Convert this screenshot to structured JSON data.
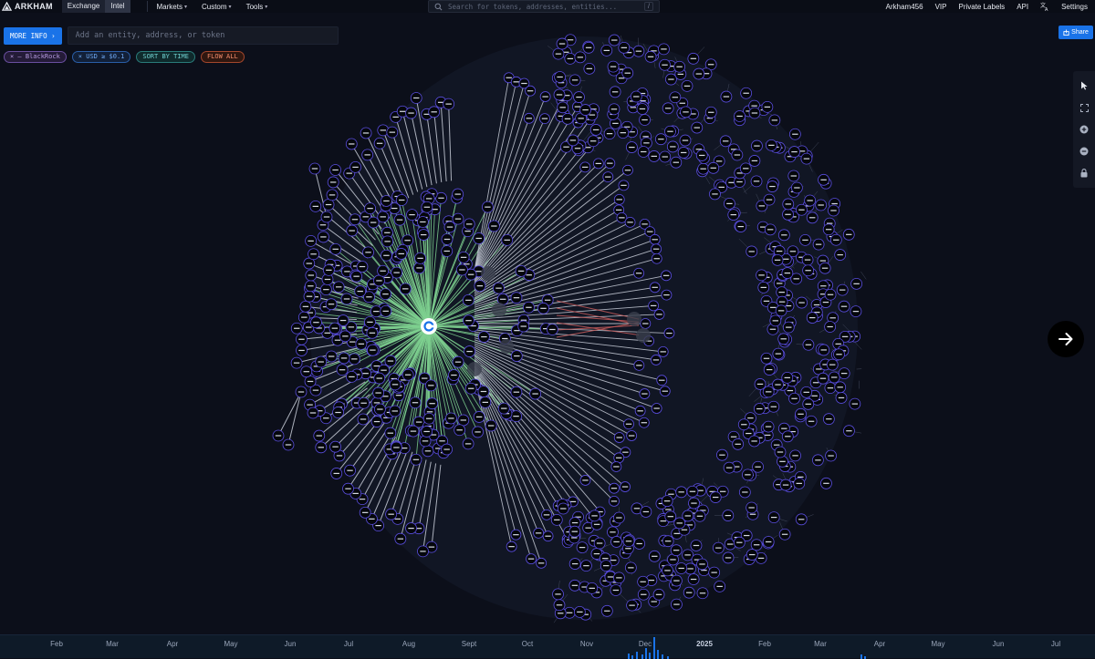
{
  "brand": {
    "name": "ARKHAM",
    "logo_icon": "arkham-logo-icon"
  },
  "mode_tabs": [
    {
      "label": "Exchange",
      "active": false
    },
    {
      "label": "Intel",
      "active": true
    }
  ],
  "nav": {
    "markets": "Markets",
    "custom": "Custom",
    "tools": "Tools"
  },
  "search": {
    "placeholder": "Search for tokens, addresses, entities...",
    "shortcut": "/"
  },
  "right_nav": {
    "user": "Arkham456",
    "vip": "VIP",
    "private_labels": "Private Labels",
    "api": "API",
    "settings": "Settings"
  },
  "toolbar": {
    "more_info": "MORE INFO",
    "entity_placeholder": "Add an entity, address, or token"
  },
  "filters": {
    "entity": "× — BlackRock",
    "usd": "× USD ≥ $0.1",
    "sort": "SORT BY TIME",
    "flow": "FLOW ALL"
  },
  "share": {
    "label": "Share"
  },
  "timeline": {
    "months": [
      {
        "label": "Feb",
        "bold": false
      },
      {
        "label": "Mar",
        "bold": false
      },
      {
        "label": "Apr",
        "bold": false
      },
      {
        "label": "May",
        "bold": false
      },
      {
        "label": "Jun",
        "bold": false
      },
      {
        "label": "Jul",
        "bold": false
      },
      {
        "label": "Aug",
        "bold": false
      },
      {
        "label": "Sept",
        "bold": false
      },
      {
        "label": "Oct",
        "bold": false
      },
      {
        "label": "Nov",
        "bold": false
      },
      {
        "label": "Dec",
        "bold": false
      },
      {
        "label": "2025",
        "bold": true
      },
      {
        "label": "Feb",
        "bold": false
      },
      {
        "label": "Mar",
        "bold": false
      },
      {
        "label": "Apr",
        "bold": false
      },
      {
        "label": "May",
        "bold": false
      },
      {
        "label": "Jun",
        "bold": false
      },
      {
        "label": "Jul",
        "bold": false
      }
    ]
  },
  "colors": {
    "accent": "#1a73e8",
    "hub": "#ffffff",
    "inflow_edge": "#7ed08f",
    "outflow_edge": "#c65a5a",
    "node_fill": "#05070c",
    "node_ring": "#5a4ee0",
    "edge": "#c8cdd8",
    "timeline_bar": "#1a73e8"
  }
}
